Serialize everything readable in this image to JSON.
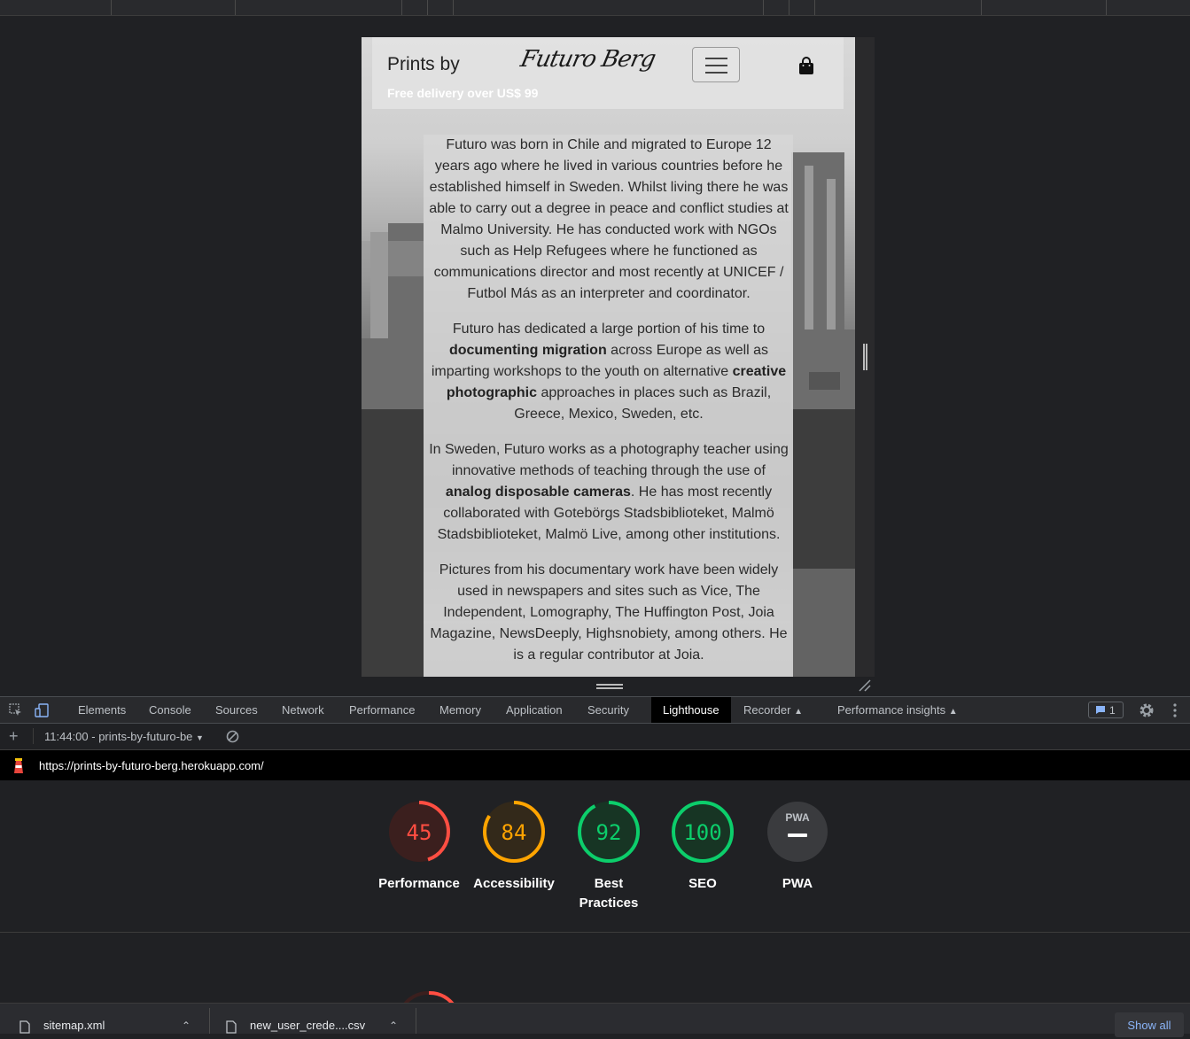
{
  "site": {
    "brand_prefix": "Prints by",
    "brand_signature": "Futuro Berg",
    "delivery_banner": "Free delivery over US$ 99",
    "about": {
      "p1": "Futuro was born in Chile and migrated to Europe 12 years ago where he lived in various countries before he established himself in Sweden. Whilst living there he was able to carry out a degree in peace and conflict studies at Malmo University. He has conducted work with NGOs such as Help Refugees where he functioned as communications director and most recently at UNICEF / Futbol Más as an interpreter and coordinator.",
      "p2_a": "Futuro has dedicated a large portion of his time to ",
      "p2_b": "documenting migration",
      "p2_c": " across Europe as well as imparting workshops to the youth on alternative ",
      "p2_d": "creative photographic",
      "p2_e": " approaches in places such as Brazil, Greece, Mexico, Sweden, etc.",
      "p3_a": "In Sweden, Futuro works as a photography teacher using innovative methods of teaching through the use of ",
      "p3_b": "analog disposable cameras",
      "p3_c": ". He has most recently collaborated with Gotebörgs Stadsbiblioteket, Malmö Stadsbiblioteket, Malmö Live, among other institutions.",
      "p4": "Pictures from his documentary work have been widely used in newspapers and sites such as Vice, The Independent, Lomography, The Huffington Post, Joia Magazine, NewsDeeply, Highsnobiety, among others. He is a regular contributor at Joia."
    }
  },
  "devtools": {
    "tabs": [
      "Elements",
      "Console",
      "Sources",
      "Network",
      "Performance",
      "Memory",
      "Application",
      "Security",
      "Lighthouse",
      "Recorder",
      "Performance insights"
    ],
    "issues_count": "1",
    "report_selector": "11:44:00 - prints-by-futuro-be",
    "report_url": "https://prints-by-futuro-berg.herokuapp.com/",
    "scores": [
      {
        "label": "Performance",
        "score": "45",
        "value": 45,
        "color": "#ff4e42",
        "bg": "#3b1f1e"
      },
      {
        "label": "Accessibility",
        "score": "84",
        "value": 84,
        "color": "#ffa400",
        "bg": "#33291a"
      },
      {
        "label": "Best Practices",
        "score": "92",
        "value": 92,
        "color": "#0cce6b",
        "bg": "#173524"
      },
      {
        "label": "SEO",
        "score": "100",
        "value": 100,
        "color": "#0cce6b",
        "bg": "#173524"
      },
      {
        "label": "PWA",
        "score": "PWA",
        "value": null,
        "color": "#9aa0a6",
        "bg": "#3a3b3e"
      }
    ]
  },
  "downloads": {
    "items": [
      "sitemap.xml",
      "new_user_crede....csv"
    ],
    "show_all": "Show all"
  }
}
